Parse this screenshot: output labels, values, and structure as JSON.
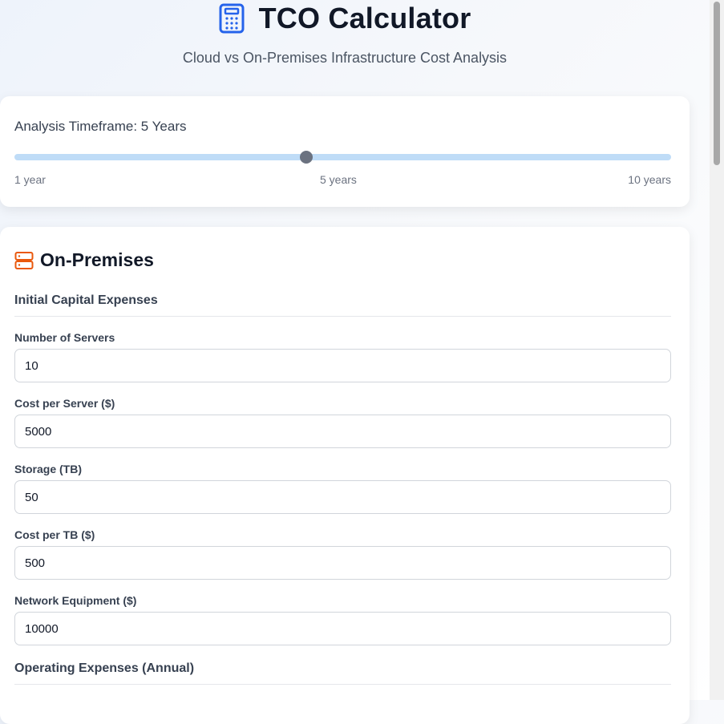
{
  "header": {
    "title": "TCO Calculator",
    "subtitle": "Cloud vs On-Premises Infrastructure Cost Analysis",
    "icon": "calculator-icon"
  },
  "timeframe": {
    "label": "Analysis Timeframe: 5 Years",
    "value": 5,
    "min": 1,
    "max": 10,
    "min_label": "1 year",
    "mid_label": "5 years",
    "max_label": "10 years"
  },
  "onprem": {
    "title": "On-Premises",
    "icon": "server-icon",
    "capex_title": "Initial Capital Expenses",
    "fields": [
      {
        "label": "Number of Servers",
        "value": "10"
      },
      {
        "label": "Cost per Server ($)",
        "value": "5000"
      },
      {
        "label": "Storage (TB)",
        "value": "50"
      },
      {
        "label": "Cost per TB ($)",
        "value": "500"
      },
      {
        "label": "Network Equipment ($)",
        "value": "10000"
      }
    ],
    "opex_title": "Operating Expenses (Annual)"
  },
  "colors": {
    "accent_blue": "#2563eb",
    "accent_orange": "#ea580c",
    "slider_track": "#bfdcf7"
  }
}
